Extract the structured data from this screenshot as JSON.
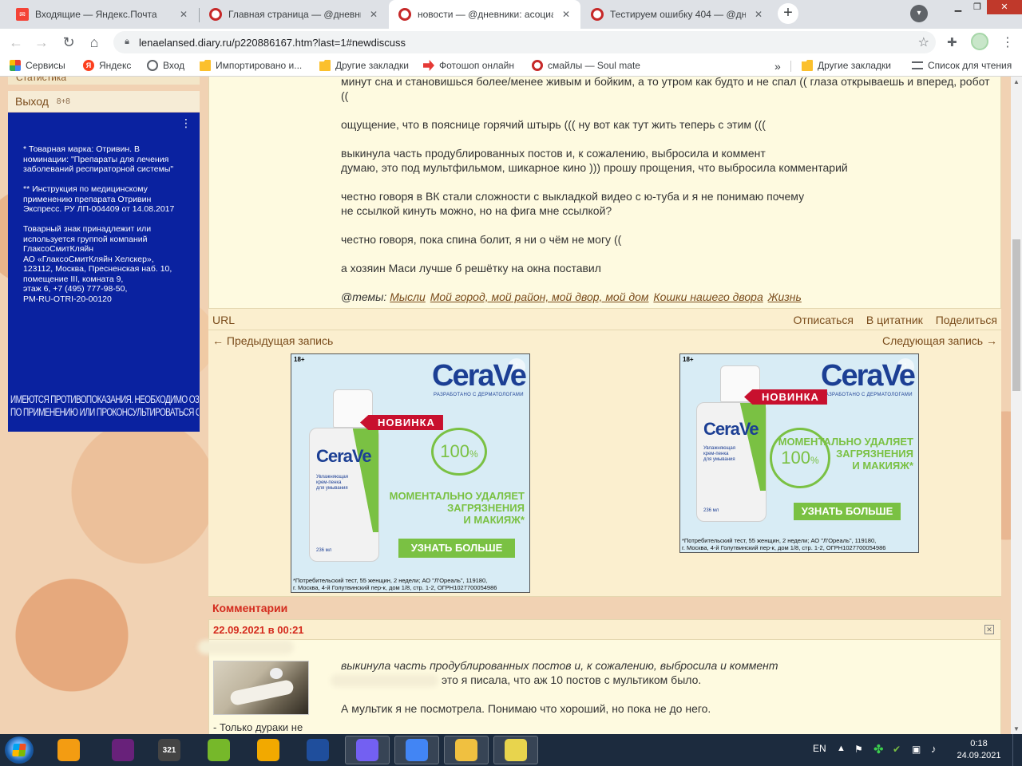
{
  "browser": {
    "tabs": [
      {
        "title": "Входящие — Яндекс.Почта",
        "icon": "mail-icon",
        "active": false
      },
      {
        "title": "Главная страница — @дневники",
        "icon": "diary-icon",
        "active": false
      },
      {
        "title": "новости — @дневники: асоциа",
        "icon": "diary-icon",
        "active": true
      },
      {
        "title": "Тестируем ошибку 404 — @дне",
        "icon": "diary-icon",
        "active": false
      }
    ],
    "new_tab_symbol": "+",
    "address": "lenaelansed.diary.ru/p220886167.htm?last=1#newdiscuss",
    "bookmarks": [
      {
        "label": "Сервисы",
        "icon": "apps-grid-icon"
      },
      {
        "label": "Яндекс",
        "icon": "yandex-icon"
      },
      {
        "label": "Вход",
        "icon": "globe-icon"
      },
      {
        "label": "Импортировано и...",
        "icon": "folder-icon"
      },
      {
        "label": "Другие закладки",
        "icon": "folder-icon"
      },
      {
        "label": "Фотошоп онлайн",
        "icon": "arrow-icon"
      },
      {
        "label": "смайлы — Soul mate",
        "icon": "diary-icon"
      }
    ],
    "bookmarks_overflow": "»",
    "bookmarks_right": [
      {
        "label": "Другие закладки",
        "icon": "folder-icon"
      },
      {
        "label": "Список для чтения",
        "icon": "reading-list-icon"
      }
    ]
  },
  "sidebar": {
    "top_cut_label": "Статистика",
    "logout_label": "Выход",
    "logout_hint": "8+8",
    "ad_text": "* Товарная марка: Отривин. В номинации: \"Препараты для лечения заболеваний респираторной системы\"\n\n** Инструкция по медицинскому применению препарата Отривин Экспресс. РУ ЛП-004409 от 14.08.2017\n\nТоварный знак принадлежит или используется группой компаний ГлаксоСмитКляйн\nАО «ГлаксоСмитКляйн Хелскер»,\n123112, Москва, Пресненская наб. 10, помещение III, комната 9,\nэтаж 6, +7 (495) 777-98-50,\nPM-RU-OTRI-20-00120",
    "ad_warning": "Имеются противопоказания. Необходимо ознакомиться с инструкцией по применению или проконсультироваться со специалистом",
    "ad_warning_line1": "Имеются противопоказания. Необходимо ознакомиться с инструкцией",
    "ad_warning_line2": "по применению или проконсультироваться со специалистом"
  },
  "post": {
    "lines": {
      "l0": "минут сна и становишься более/менее живым и бойким, а то утром как будто и не спал (( глаза открываешь и вперед, робот",
      "l1": "((",
      "l2": "ощущение, что в пояснице горячий штырь ((( ну вот как тут жить теперь с этим (((",
      "l3": "выкинула часть продублированных постов и, к сожалению, выбросила и коммент",
      "l4": "думаю, это под мультфильмом, шикарное кино ))) прошу прощения, что выбросила комментарий",
      "l5": "честно говоря в ВК стали сложности с выкладкой видео с ю-туба и я не понимаю почему",
      "l6": "не ссылкой кинуть можно, но на фига мне ссылкой?",
      "l7": "честно говоря, пока спина болит, я ни о чём не могу ((",
      "l8": "а хозяин Маси лучше б решётку на окна поставил"
    },
    "tags_prefix": "@темы:",
    "tags": [
      "Мысли",
      "Мой город, мой район, мой двор, мой дом",
      "Кошки нашего двора",
      "Жизнь"
    ],
    "url_label": "URL",
    "actions": [
      "Отписаться",
      "В цитатник",
      "Поделиться"
    ],
    "prev_label": "← Предыдущая запись",
    "next_label": "Следующая запись →"
  },
  "ad": {
    "age": "18+",
    "brand": "CeraVe",
    "brand_sub": "РАЗРАБОТАНО С ДЕРМАТОЛОГАМИ",
    "badge": "НОВИНКА",
    "percent": "100",
    "percent_sign": "%",
    "claim": "МОМЕНТАЛЬНО УДАЛЯЕТ\nЗАГРЯЗНЕНИЯ\nИ МАКИЯЖ*",
    "cta": "УЗНАТЬ БОЛЬШЕ",
    "bottle_text": "Увлажняющая\nкрем-пенка\nдля умывания",
    "bottle_volume": "236 мл",
    "fineprint": "*Потребительский тест, 55 женщин, 2 недели; АО \"Л'Ореаль\", 119180,\nг. Москва, 4-й Голутвинский пер-к, дом 1/8, стр. 1-2, ОГРН1027700054986"
  },
  "comments": {
    "header": "Комментарии",
    "date": "22.09.2021 в 00:21",
    "author_caption": "- Только дураки не",
    "quote": "выкинула часть продублированных постов и, к сожалению, выбросила и коммент",
    "line2": "это я писала, что аж 10 постов с мультиком было.",
    "line3": "А мультик я не посмотрела. Понимаю что хороший, но пока не до него."
  },
  "taskbar": {
    "apps": [
      {
        "name": "media-player-icon",
        "color": "#f39c12"
      },
      {
        "name": "visual-studio-icon",
        "color": "#68217a"
      },
      {
        "name": "calendar-321-icon",
        "color": "#444444",
        "label": "321"
      },
      {
        "name": "utorrent-icon",
        "color": "#76b82a"
      },
      {
        "name": "aimp-icon",
        "color": "#f2a900"
      },
      {
        "name": "save-disk-icon",
        "color": "#1f4e9c"
      },
      {
        "name": "viber-icon",
        "color": "#7360f2"
      },
      {
        "name": "chrome-icon",
        "color": "#4285f4"
      },
      {
        "name": "file-explorer-icon",
        "color": "#f0c040"
      },
      {
        "name": "sticky-notes-icon",
        "color": "#e8d44d"
      }
    ],
    "lang": "EN",
    "time": "0:18",
    "date": "24.09.2021"
  }
}
